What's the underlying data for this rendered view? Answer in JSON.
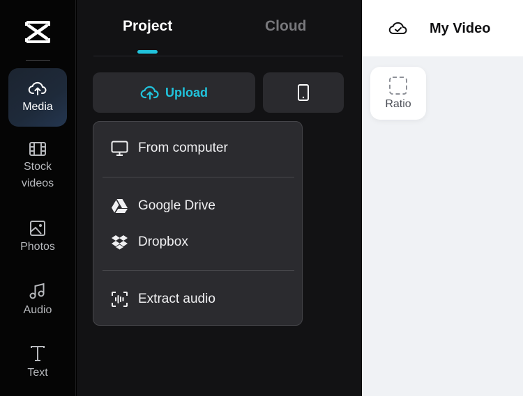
{
  "sidebar": {
    "logo": "capcut-logo",
    "items": [
      {
        "label": "Media",
        "icon": "cloud-upload-icon",
        "active": true
      },
      {
        "label": "Stock\nvideos",
        "label_line1": "Stock",
        "label_line2": "videos",
        "icon": "film-icon",
        "active": false
      },
      {
        "label": "Photos",
        "icon": "image-icon",
        "active": false
      },
      {
        "label": "Audio",
        "icon": "music-note-icon",
        "active": false
      },
      {
        "label": "Text",
        "icon": "text-icon",
        "active": false
      }
    ]
  },
  "panel": {
    "tabs": [
      {
        "label": "Project",
        "active": true
      },
      {
        "label": "Cloud",
        "active": false
      }
    ],
    "upload_button": {
      "label": "Upload",
      "icon": "cloud-upload-icon"
    },
    "phone_button": {
      "icon": "smartphone-icon"
    },
    "upload_menu": {
      "items": [
        {
          "label": "From computer",
          "icon": "monitor-icon"
        },
        {
          "label": "Google Drive",
          "icon": "google-drive-icon"
        },
        {
          "label": "Dropbox",
          "icon": "dropbox-icon"
        },
        {
          "label": "Extract audio",
          "icon": "audio-extract-icon"
        }
      ]
    }
  },
  "editor": {
    "title": "My Video",
    "save_status_icon": "cloud-check-icon",
    "ratio_button": {
      "label": "Ratio",
      "icon": "dashed-square-icon"
    }
  },
  "colors": {
    "accent": "#21c3dc",
    "panel_bg": "#121214",
    "menu_bg": "#2b2b2f",
    "canvas_bg": "#f0f2f5"
  }
}
